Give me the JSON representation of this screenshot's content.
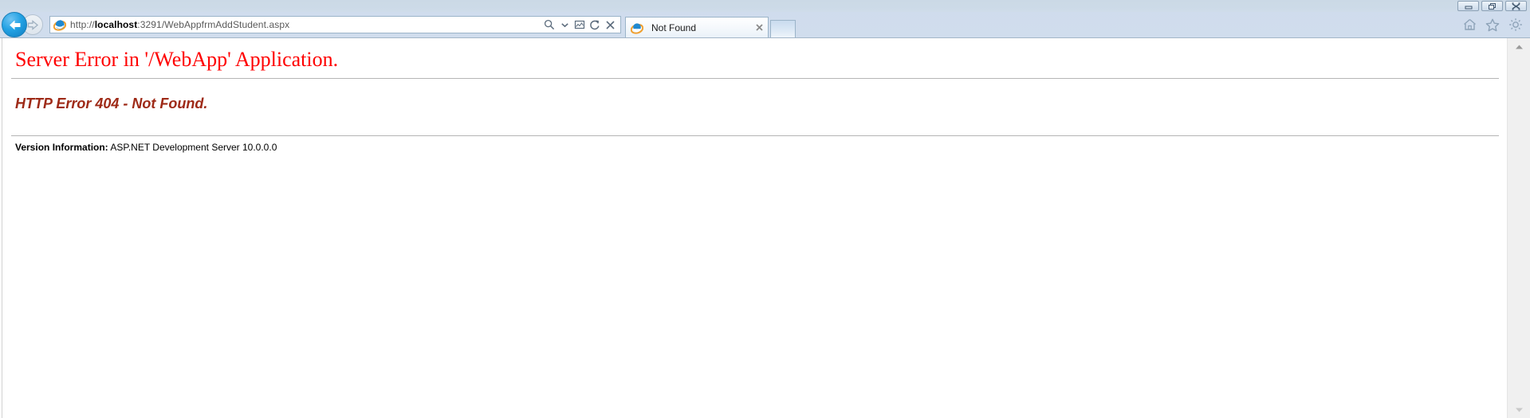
{
  "window": {
    "controls": [
      {
        "name": "minimize",
        "label": "Minimize"
      },
      {
        "name": "restore",
        "label": "Restore"
      },
      {
        "name": "close",
        "label": "Close"
      }
    ]
  },
  "navigation": {
    "back_label": "Back",
    "forward_label": "Forward"
  },
  "address_bar": {
    "scheme": "http://",
    "host": "localhost",
    "path": ":3291/WebAppfrmAddStudent.aspx",
    "full_url": "http://localhost:3291/WebAppfrmAddStudent.aspx",
    "placeholder": "",
    "icons": [
      {
        "name": "search-icon",
        "label": "Search"
      },
      {
        "name": "chevron-down-icon",
        "label": "Search options"
      },
      {
        "name": "compatibility-view-icon",
        "label": "Compatibility View"
      },
      {
        "name": "refresh-icon",
        "label": "Refresh"
      },
      {
        "name": "stop-icon",
        "label": "Stop"
      }
    ]
  },
  "tabs": [
    {
      "title": "Not Found",
      "close_label": "Close Tab",
      "active": true
    }
  ],
  "new_tab_label": "New Tab",
  "toolbar": {
    "icons": [
      {
        "name": "home-icon",
        "label": "Home"
      },
      {
        "name": "favorites-icon",
        "label": "Favorites"
      },
      {
        "name": "settings-icon",
        "label": "Tools"
      }
    ]
  },
  "page": {
    "error_title": "Server Error in '/WebApp' Application.",
    "error_subtitle": "HTTP Error 404 - Not Found.",
    "version_label": "Version Information:",
    "version_value": " ASP.NET Development Server 10.0.0.0"
  },
  "scrollbar": {
    "up_label": "Scroll Up",
    "down_label": "Scroll Down"
  },
  "colors": {
    "error_red": "#ff0000",
    "error_dark_red": "#9e2a17",
    "chrome_blue": "#d3e0ee",
    "rule_gray": "#b5b5b5"
  }
}
